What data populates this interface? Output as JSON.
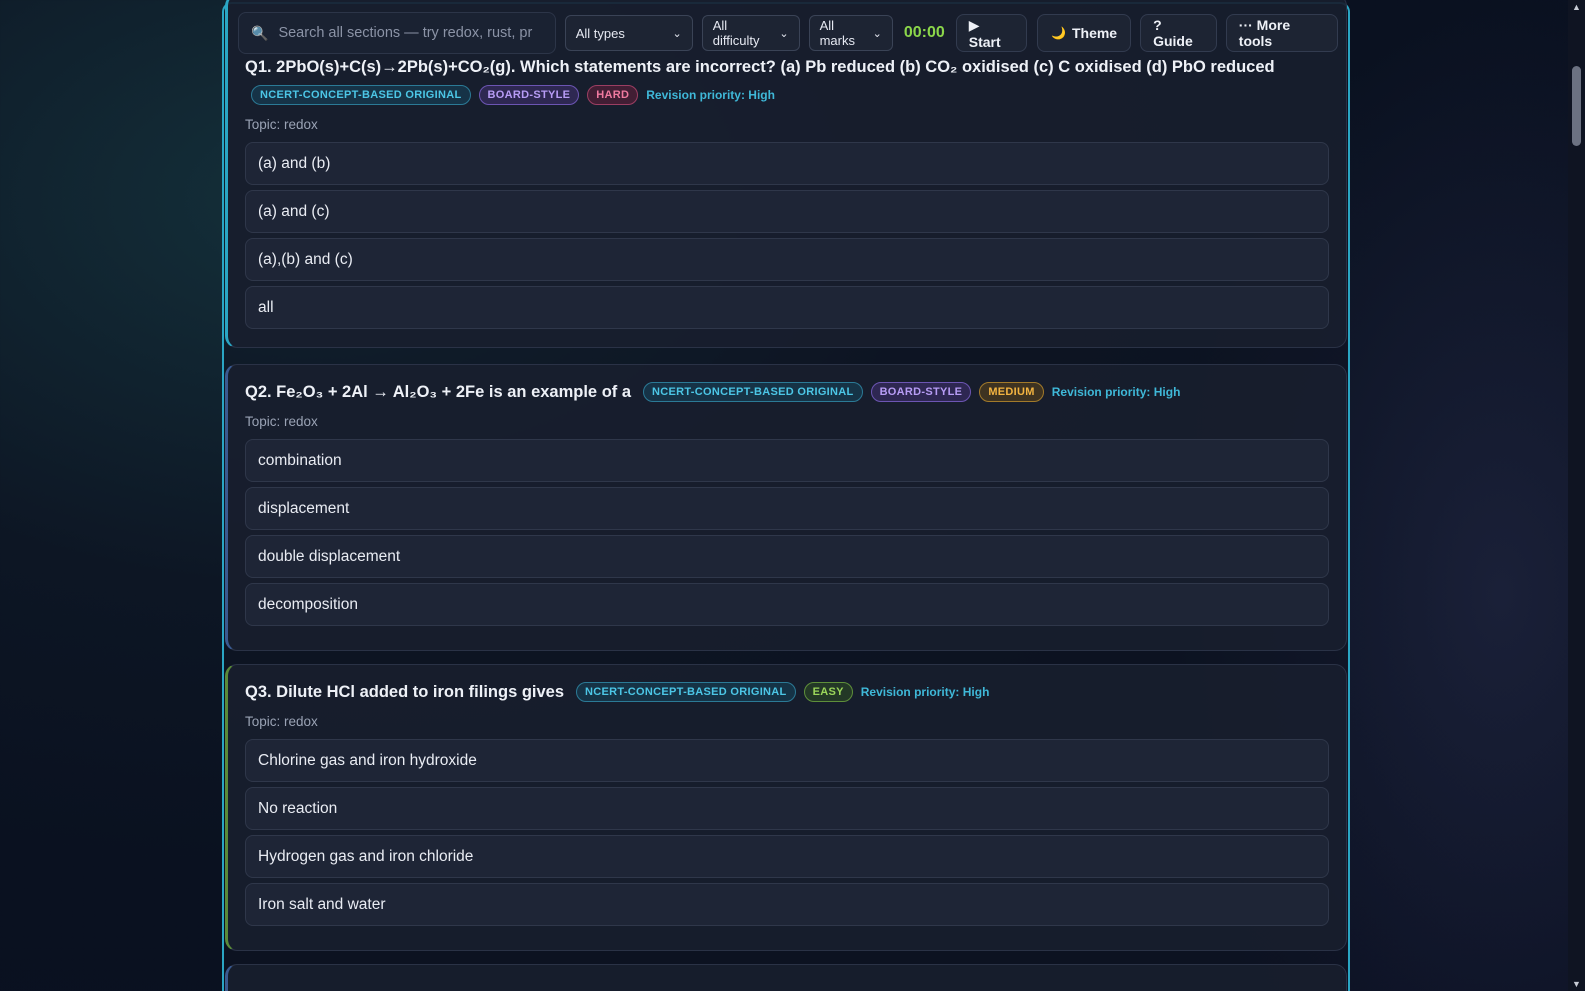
{
  "toolbar": {
    "search_placeholder": "Search all sections — try redox, rust, pr",
    "filter_types": "All types",
    "filter_difficulty": "All difficulty",
    "filter_marks": "All marks",
    "timer": "00:00",
    "start_label": "▶ Start",
    "theme_label": "Theme",
    "guide_label": "? Guide",
    "more_label": "··· More tools"
  },
  "icons": {
    "search": "🔍",
    "theme": "🌙",
    "chevron": "⌄"
  },
  "questions": [
    {
      "title": "Q1. 2PbO(s)+C(s)→2Pb(s)+CO₂(g). Which statements are incorrect? (a) Pb reduced (b) CO₂ oxidised (c) C oxidised (d) PbO reduced",
      "badges": [
        "NCERT-CONCEPT-BASED ORIGINAL",
        "BOARD-STYLE",
        "HARD"
      ],
      "priority": "Revision priority: High",
      "topic": "Topic: redox",
      "options": [
        "(a) and (b)",
        "(a) and (c)",
        "(a),(b) and (c)",
        "all"
      ]
    },
    {
      "title": "Q2. Fe₂O₃ + 2Al → Al₂O₃ + 2Fe is an example of a",
      "badges": [
        "NCERT-CONCEPT-BASED ORIGINAL",
        "BOARD-STYLE",
        "MEDIUM"
      ],
      "priority": "Revision priority: High",
      "topic": "Topic: redox",
      "options": [
        "combination",
        "displacement",
        "double displacement",
        "decomposition"
      ]
    },
    {
      "title": "Q3. Dilute HCl added to iron filings gives",
      "badges": [
        "NCERT-CONCEPT-BASED ORIGINAL",
        "EASY"
      ],
      "priority": "Revision priority: High",
      "topic": "Topic: redox",
      "options": [
        "Chlorine gas and iron hydroxide",
        "No reaction",
        "Hydrogen gas and iron chloride",
        "Iron salt and water"
      ]
    }
  ],
  "colors": {
    "accent": "#2aa6c4",
    "timer": "#8bd64a"
  }
}
